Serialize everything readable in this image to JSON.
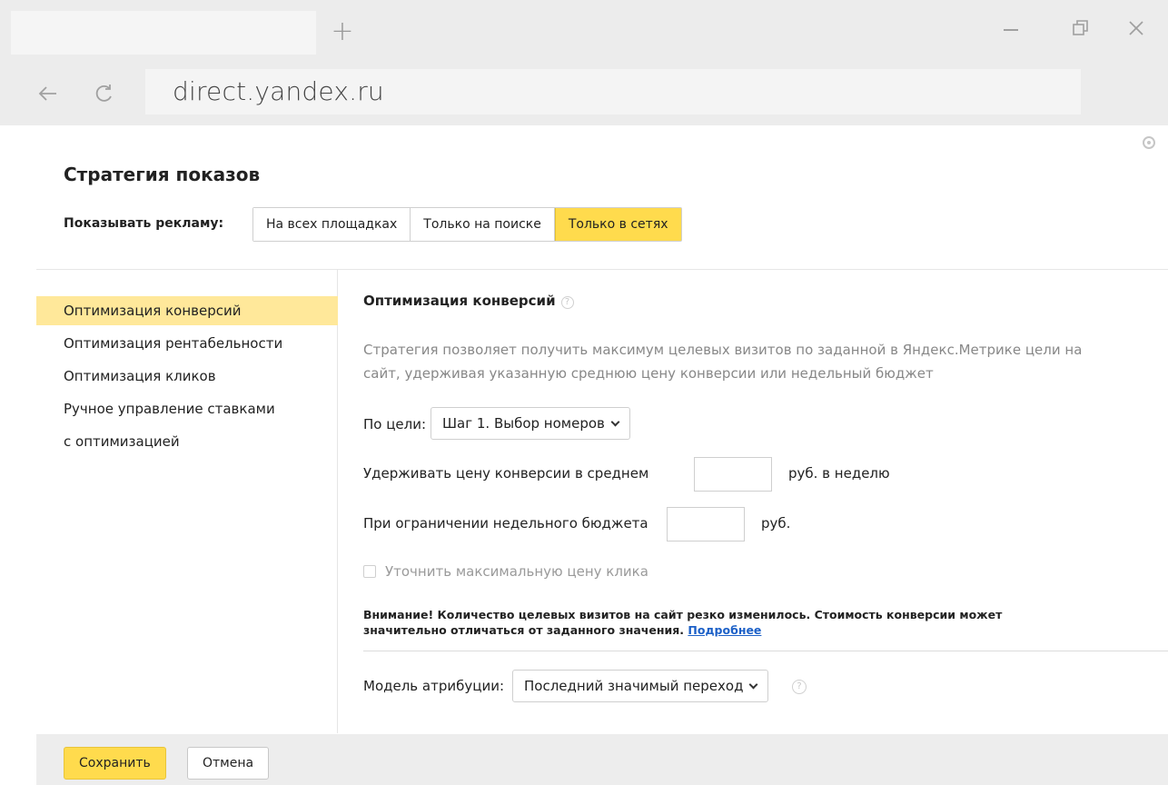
{
  "browser": {
    "new_tab_glyph": "+",
    "url": "direct.yandex.ru",
    "icons": {
      "new_tab": "plus-icon",
      "minimize": "minimize-icon",
      "restore": "restore-icon",
      "close": "close-icon",
      "back": "arrow-left-icon",
      "reload": "reload-icon"
    }
  },
  "dialog": {
    "title": "Стратегия показов",
    "show_ads_label": "Показывать рекламу:",
    "placement_tabs": [
      {
        "label": "На всех площадках",
        "active": false
      },
      {
        "label": "Только на поиске",
        "active": false
      },
      {
        "label": "Только в сетях",
        "active": true
      }
    ]
  },
  "sidebar": {
    "items": [
      {
        "label": "Оптимизация конверсий",
        "active": true
      },
      {
        "label": "Оптимизация рентабельности",
        "active": false
      },
      {
        "label": "Оптимизация кликов",
        "active": false
      },
      {
        "label": "Ручное управление ставками",
        "active": false
      },
      {
        "label": "с оптимизацией",
        "active": false
      }
    ]
  },
  "main": {
    "section_title": "Оптимизация конверсий",
    "help_glyph": "?",
    "description": "Стратегия позволяет получить максимум целевых визитов по заданной в Яндекс.Метрике цели на сайт, удерживая указанную среднюю цену конверсии или недельный бюджет",
    "goal_label": "По цели:",
    "goal_value": "Шаг 1. Выбор номеров",
    "avg_cpa_label": "Удерживать цену конверсии в среднем",
    "avg_cpa_value": "",
    "avg_cpa_unit": "руб. в неделю",
    "weekly_budget_label": "При ограничении недельного бюджета",
    "weekly_budget_value": "",
    "weekly_budget_unit": "руб.",
    "max_click_price_label": "Уточнить максимальную цену клика",
    "max_click_price_checked": false,
    "warning_text": "Внимание! Количество целевых визитов на сайт резко изменилось. Стоимость конверсии может значительно отличаться от заданного значения.",
    "warning_link": "Подробнее",
    "attribution_label": "Модель атрибуции:",
    "attribution_value": "Последний значимый переход"
  },
  "footer": {
    "save_label": "Сохранить",
    "cancel_label": "Отмена"
  },
  "colors": {
    "accent_yellow": "#ffdb4d",
    "sidebar_active": "#ffe89a",
    "link_blue": "#1c60c7"
  }
}
